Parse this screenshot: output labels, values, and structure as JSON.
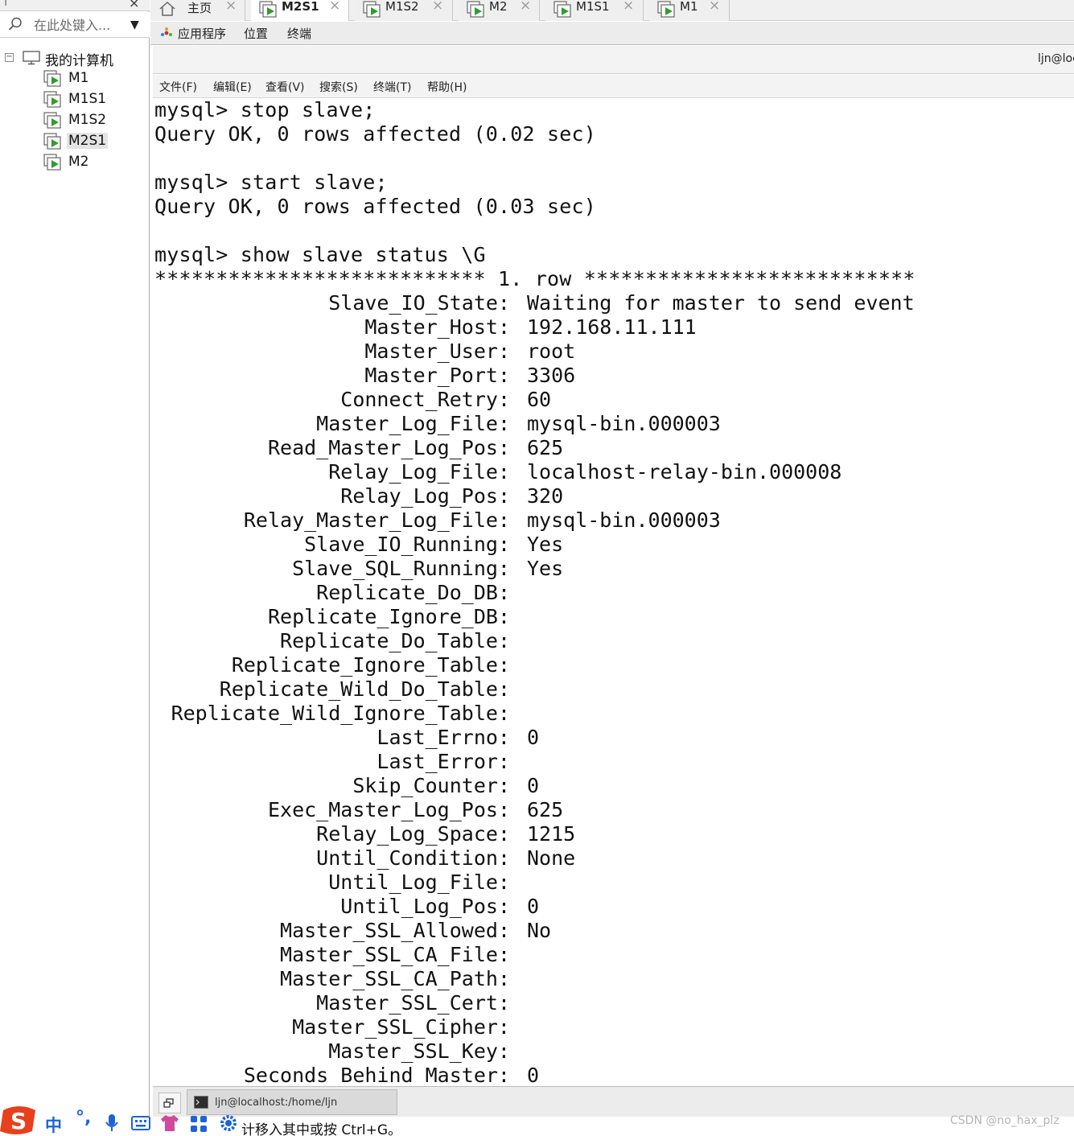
{
  "library": {
    "search_placeholder": "在此处键入...",
    "tree_root": "我的计算机",
    "vms": [
      {
        "name": "M1",
        "selected": false
      },
      {
        "name": "M1S1",
        "selected": false
      },
      {
        "name": "M1S2",
        "selected": false
      },
      {
        "name": "M2S1",
        "selected": true
      },
      {
        "name": "M2",
        "selected": false
      }
    ]
  },
  "tabs": [
    {
      "label": "主页",
      "icon": "home-icon",
      "active": false
    },
    {
      "label": "M2S1",
      "icon": "vm-icon",
      "active": true
    },
    {
      "label": "M1S2",
      "icon": "vm-icon",
      "active": false
    },
    {
      "label": "M2",
      "icon": "vm-icon",
      "active": false
    },
    {
      "label": "M1S1",
      "icon": "vm-icon",
      "active": false
    },
    {
      "label": "M1",
      "icon": "vm-icon",
      "active": false
    }
  ],
  "guest_panel": {
    "applications": "应用程序",
    "places": "位置",
    "terminal": "终端"
  },
  "terminal_window": {
    "title": "ljn@loc",
    "menu": [
      "文件(F)",
      "编辑(E)",
      "查看(V)",
      "搜索(S)",
      "终端(T)",
      "帮助(H)"
    ],
    "lines": [
      "mysql> stop slave;",
      "Query OK, 0 rows affected (0.02 sec)",
      "",
      "mysql> start slave;",
      "Query OK, 0 rows affected (0.03 sec)",
      "",
      "mysql> show slave status \\G",
      "*************************** 1. row ***************************"
    ],
    "status_fields": [
      {
        "k": "Slave_IO_State:",
        "v": "Waiting for master to send event"
      },
      {
        "k": "Master_Host:",
        "v": "192.168.11.111"
      },
      {
        "k": "Master_User:",
        "v": "root"
      },
      {
        "k": "Master_Port:",
        "v": "3306"
      },
      {
        "k": "Connect_Retry:",
        "v": "60"
      },
      {
        "k": "Master_Log_File:",
        "v": "mysql-bin.000003"
      },
      {
        "k": "Read_Master_Log_Pos:",
        "v": "625"
      },
      {
        "k": "Relay_Log_File:",
        "v": "localhost-relay-bin.000008"
      },
      {
        "k": "Relay_Log_Pos:",
        "v": "320"
      },
      {
        "k": "Relay_Master_Log_File:",
        "v": "mysql-bin.000003"
      },
      {
        "k": "Slave_IO_Running:",
        "v": "Yes"
      },
      {
        "k": "Slave_SQL_Running:",
        "v": "Yes"
      },
      {
        "k": "Replicate_Do_DB:",
        "v": ""
      },
      {
        "k": "Replicate_Ignore_DB:",
        "v": ""
      },
      {
        "k": "Replicate_Do_Table:",
        "v": ""
      },
      {
        "k": "Replicate_Ignore_Table:",
        "v": ""
      },
      {
        "k": "Replicate_Wild_Do_Table:",
        "v": ""
      },
      {
        "k": "Replicate_Wild_Ignore_Table:",
        "v": ""
      },
      {
        "k": "Last_Errno:",
        "v": "0"
      },
      {
        "k": "Last_Error:",
        "v": ""
      },
      {
        "k": "Skip_Counter:",
        "v": "0"
      },
      {
        "k": "Exec_Master_Log_Pos:",
        "v": "625"
      },
      {
        "k": "Relay_Log_Space:",
        "v": "1215"
      },
      {
        "k": "Until_Condition:",
        "v": "None"
      },
      {
        "k": "Until_Log_File:",
        "v": ""
      },
      {
        "k": "Until_Log_Pos:",
        "v": "0"
      },
      {
        "k": "Master_SSL_Allowed:",
        "v": "No"
      },
      {
        "k": "Master_SSL_CA_File:",
        "v": ""
      },
      {
        "k": "Master_SSL_CA_Path:",
        "v": ""
      },
      {
        "k": "Master_SSL_Cert:",
        "v": ""
      },
      {
        "k": "Master_SSL_Cipher:",
        "v": ""
      },
      {
        "k": "Master_SSL_Key:",
        "v": ""
      },
      {
        "k": "Seconds_Behind_Master:",
        "v": "0"
      }
    ]
  },
  "guest_taskbar": {
    "task_label": "ljn@localhost:/home/ljn"
  },
  "host": {
    "ime_mode": "中",
    "ime_punct": "°,",
    "status_text": "计移入其中或按 Ctrl+G。",
    "watermark": "CSDN @no_hax_plz"
  },
  "colors": {
    "vm_green": "#2e9e2e",
    "ime_blue": "#1d63d6",
    "sogou_red": "#e8401c"
  }
}
